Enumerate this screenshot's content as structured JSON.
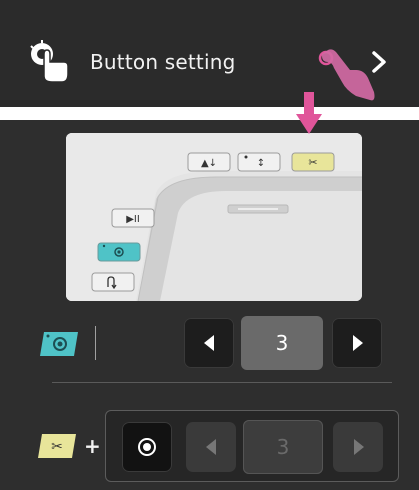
{
  "header": {
    "title": "Button setting",
    "tap_icon": "finger-tap-icon",
    "press_hand": "hand-pointer-icon",
    "chevron": "chevron-right-icon"
  },
  "illustration": {
    "buttons": [
      "presser-foot-icon",
      "needle-position-icon",
      "thread-cutter-icon",
      "start-stop-icon",
      "reinforcement-icon",
      "reverse-icon"
    ],
    "arrow": "down-arrow-icon"
  },
  "setting_row": {
    "badge_icon": "reinforcement-button-icon",
    "decrease_icon": "triangle-left-icon",
    "increase_icon": "triangle-right-icon",
    "value": "3"
  },
  "combo_row": {
    "badge_icon": "thread-cutter-button-icon",
    "plus": "+",
    "toggle_icon": "radio-circle-icon",
    "value": "3"
  },
  "colors": {
    "accent_teal": "#4fc3c7",
    "accent_yellow": "#e8e59a",
    "accent_pink": "#e0559a",
    "panel": "#2e2e2e"
  }
}
